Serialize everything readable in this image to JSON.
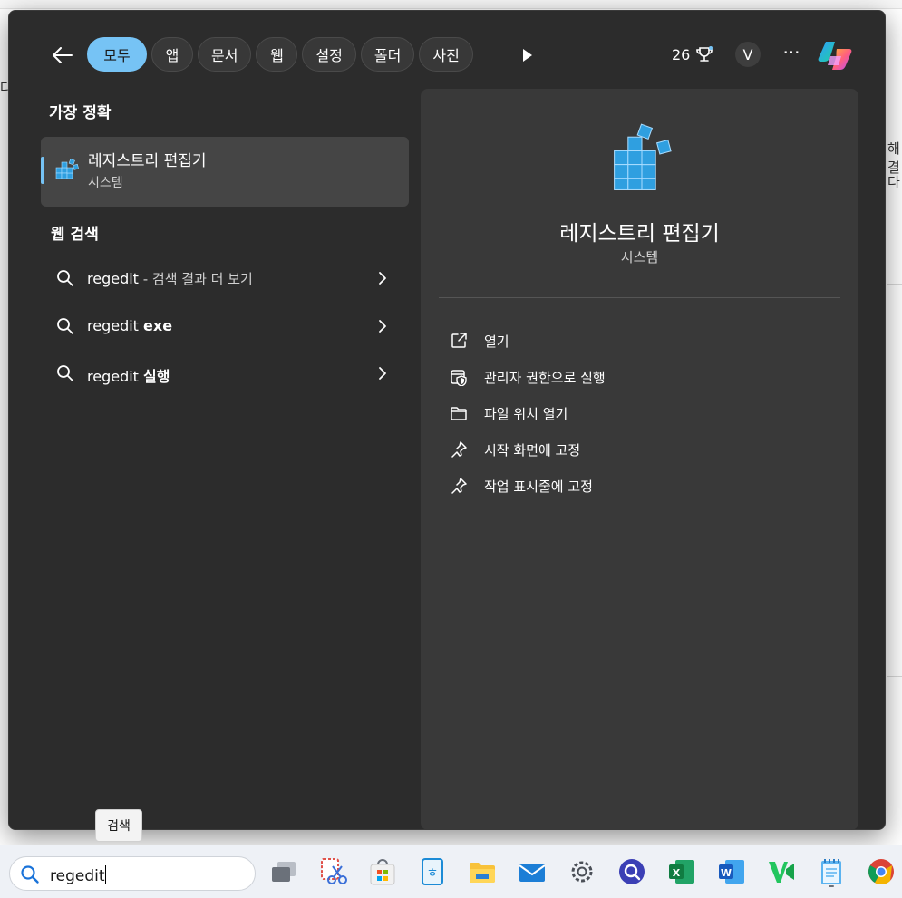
{
  "flyout": {
    "filters": [
      {
        "label": "모두",
        "active": true
      },
      {
        "label": "앱",
        "active": false
      },
      {
        "label": "문서",
        "active": false
      },
      {
        "label": "웹",
        "active": false
      },
      {
        "label": "설정",
        "active": false
      },
      {
        "label": "폴더",
        "active": false
      },
      {
        "label": "사진",
        "active": false
      }
    ],
    "points": "26",
    "avatar_letter": "V",
    "more_glyph": "···"
  },
  "left": {
    "best_match_title": "가장 정확",
    "best_match": {
      "name": "레지스트리 편집기",
      "sub": "시스템",
      "icon": "registry-editor-icon"
    },
    "web_title": "웹 검색",
    "web_results": [
      {
        "query": "regedit",
        "suffix_bold": "",
        "hint": " - 검색 결과 더 보기"
      },
      {
        "query": "regedit ",
        "suffix_bold": "exe",
        "hint": ""
      },
      {
        "query": "regedit ",
        "suffix_bold": "실행",
        "hint": ""
      }
    ]
  },
  "detail": {
    "title": "레지스트리 편집기",
    "subtitle": "시스템",
    "actions": [
      {
        "label": "열기",
        "icon": "open-external-icon"
      },
      {
        "label": "관리자 권한으로 실행",
        "icon": "admin-shield-icon"
      },
      {
        "label": "파일 위치 열기",
        "icon": "folder-icon"
      },
      {
        "label": "시작 화면에 고정",
        "icon": "pin-icon"
      },
      {
        "label": "작업 표시줄에 고정",
        "icon": "pin-icon"
      }
    ]
  },
  "tooltip": "검색",
  "taskbar": {
    "search_value": "regedit",
    "apps": [
      "task-view-icon",
      "snipping-tool-icon",
      "microsoft-store-icon",
      "hangul-app-icon",
      "file-explorer-icon",
      "mail-icon",
      "settings-icon",
      "search-app-icon",
      "excel-icon",
      "word-icon",
      "vs-app-icon",
      "notepad-icon",
      "chrome-icon"
    ]
  },
  "background": {
    "fragments": [
      "다",
      "해결",
      "다"
    ]
  },
  "colors": {
    "accent": "#76c3f5",
    "flyout_bg": "#2c2c2c",
    "detail_bg": "#393939",
    "taskbar_bg": "#eef1f6"
  }
}
